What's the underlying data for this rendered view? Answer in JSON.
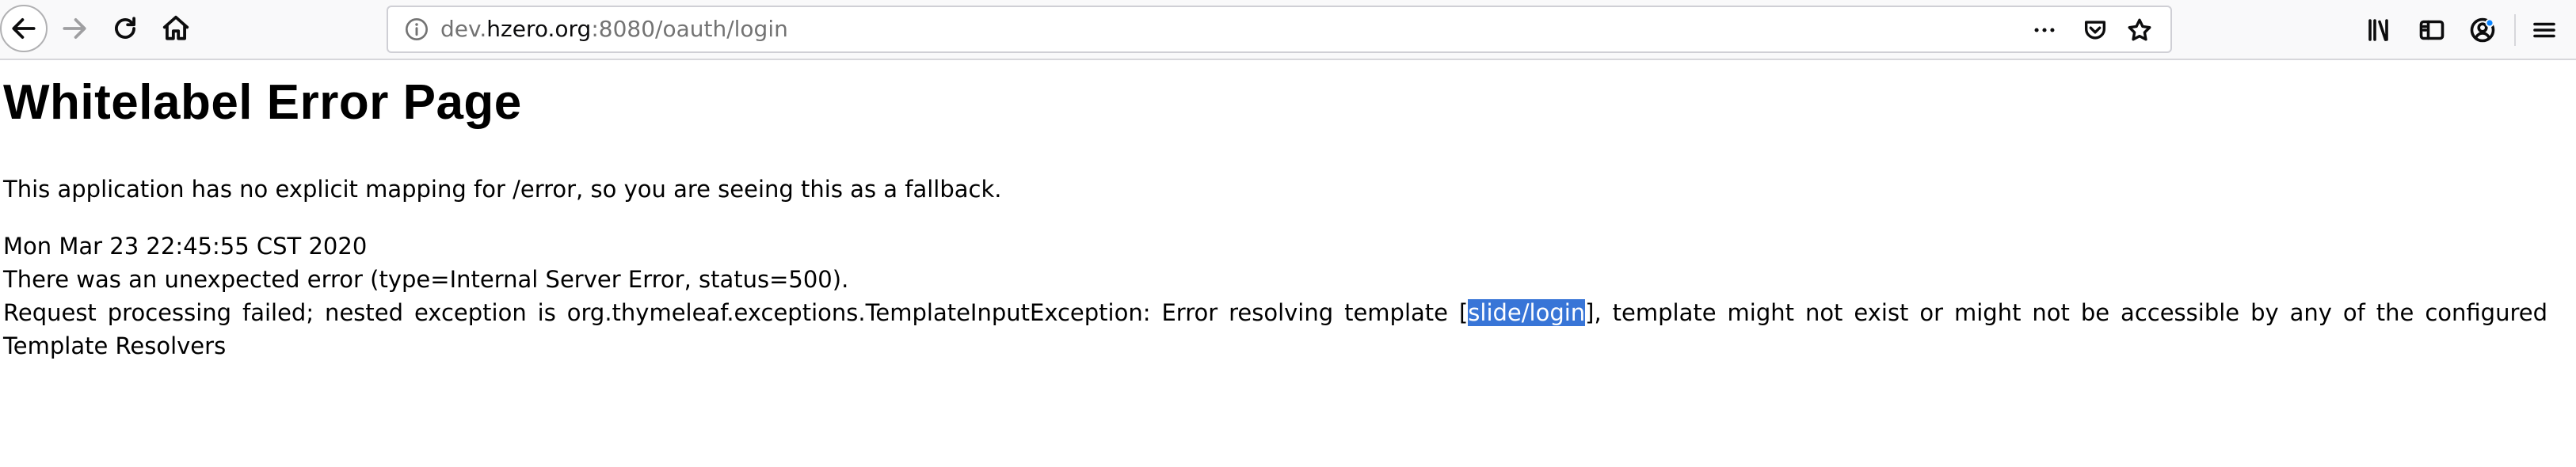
{
  "browser": {
    "url_scheme_host_prefix": "dev.",
    "url_host": "hzero.org",
    "url_rest": ":8080/oauth/login",
    "icons": {
      "back": "back-arrow-icon",
      "forward": "forward-arrow-icon",
      "reload": "reload-icon",
      "home": "home-icon",
      "info": "info-icon",
      "page_actions": "more-horizontal-icon",
      "pocket": "pocket-icon",
      "bookmark": "star-icon",
      "library": "library-icon",
      "sidebar": "sidebar-icon",
      "account": "account-icon",
      "menu": "hamburger-menu-icon"
    }
  },
  "page": {
    "title": "Whitelabel Error Page",
    "fallback_text": "This application has no explicit mapping for /error, so you are seeing this as a fallback.",
    "timestamp": "Mon Mar 23 22:45:55 CST 2020",
    "error_line": "There was an unexpected error (type=Internal Server Error, status=500).",
    "detail_before": "Request processing failed; nested exception is org.thymeleaf.exceptions.TemplateInputException: Error resolving template [",
    "detail_selected": "slide/login",
    "detail_after": "], template might not exist or might not be accessible by any of the configured Template Resolvers"
  },
  "colors": {
    "selection": "#3875d7",
    "toolbar_bg": "#f9f9fa"
  }
}
